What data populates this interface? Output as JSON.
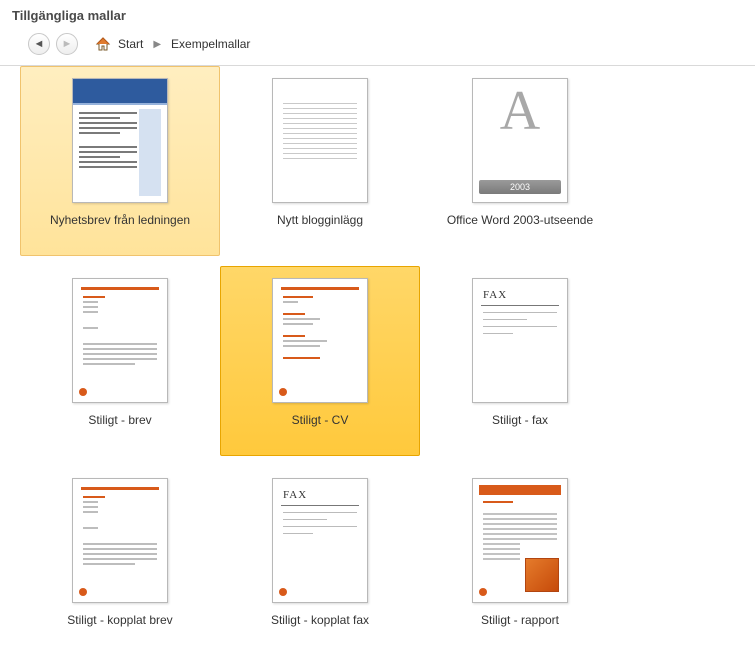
{
  "header": {
    "title": "Tillgängliga mallar"
  },
  "breadcrumb": {
    "home": "Start",
    "current": "Exempelmallar"
  },
  "word2003": {
    "letter": "A",
    "year": "2003"
  },
  "fax": {
    "label": "FAX"
  },
  "templates": [
    {
      "label": "Nyhetsbrev från ledningen"
    },
    {
      "label": "Nytt blogginlägg"
    },
    {
      "label": "Office Word 2003-utseende"
    },
    {
      "label": "Stiligt - brev"
    },
    {
      "label": "Stiligt - CV"
    },
    {
      "label": "Stiligt - fax"
    },
    {
      "label": "Stiligt - kopplat brev"
    },
    {
      "label": "Stiligt - kopplat fax"
    },
    {
      "label": "Stiligt - rapport"
    }
  ]
}
